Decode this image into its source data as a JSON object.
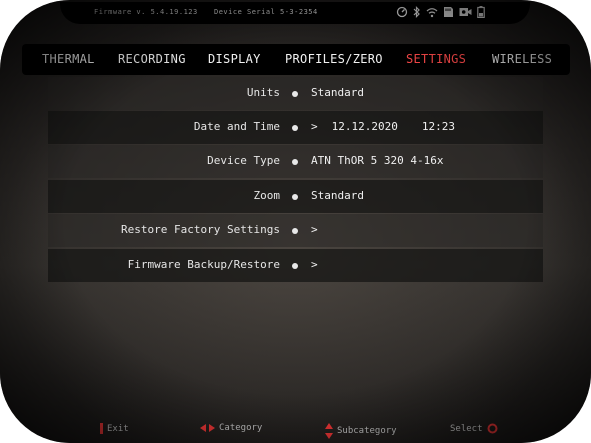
{
  "status": {
    "firmware": "Firmware v. 5.4.19.123",
    "serial": "Device Serial 5-3-2354",
    "icons": [
      "gauge-icon",
      "bluetooth-icon",
      "wifi-icon",
      "sd-card-icon",
      "camera-icon",
      "battery-icon"
    ]
  },
  "tabs": [
    {
      "label": "THERMAL",
      "active": false
    },
    {
      "label": "RECORDING",
      "active": false
    },
    {
      "label": "DISPLAY",
      "active": false
    },
    {
      "label": "PROFILES/ZERO",
      "active": false
    },
    {
      "label": "SETTINGS",
      "active": true
    },
    {
      "label": "WIRELESS",
      "active": false
    }
  ],
  "rows": [
    {
      "label": "Units",
      "value": "Standard"
    },
    {
      "label": "Date and Time",
      "arrow": ">",
      "date": "12.12.2020",
      "time": "12:23"
    },
    {
      "label": "Device Type",
      "value": "ATN ThOR 5 320 4-16x"
    },
    {
      "label": "Zoom",
      "value": "Standard"
    },
    {
      "label": "Restore Factory Settings",
      "arrow": ">"
    },
    {
      "label": "Firmware Backup/Restore",
      "arrow": ">"
    }
  ],
  "hints": {
    "exit": "Exit",
    "category": "Category",
    "subcategory": "Subcategory",
    "select": "Select"
  },
  "colors": {
    "accent": "#ff4a4a",
    "text": "#f0f0f0",
    "bar": "#000000"
  }
}
